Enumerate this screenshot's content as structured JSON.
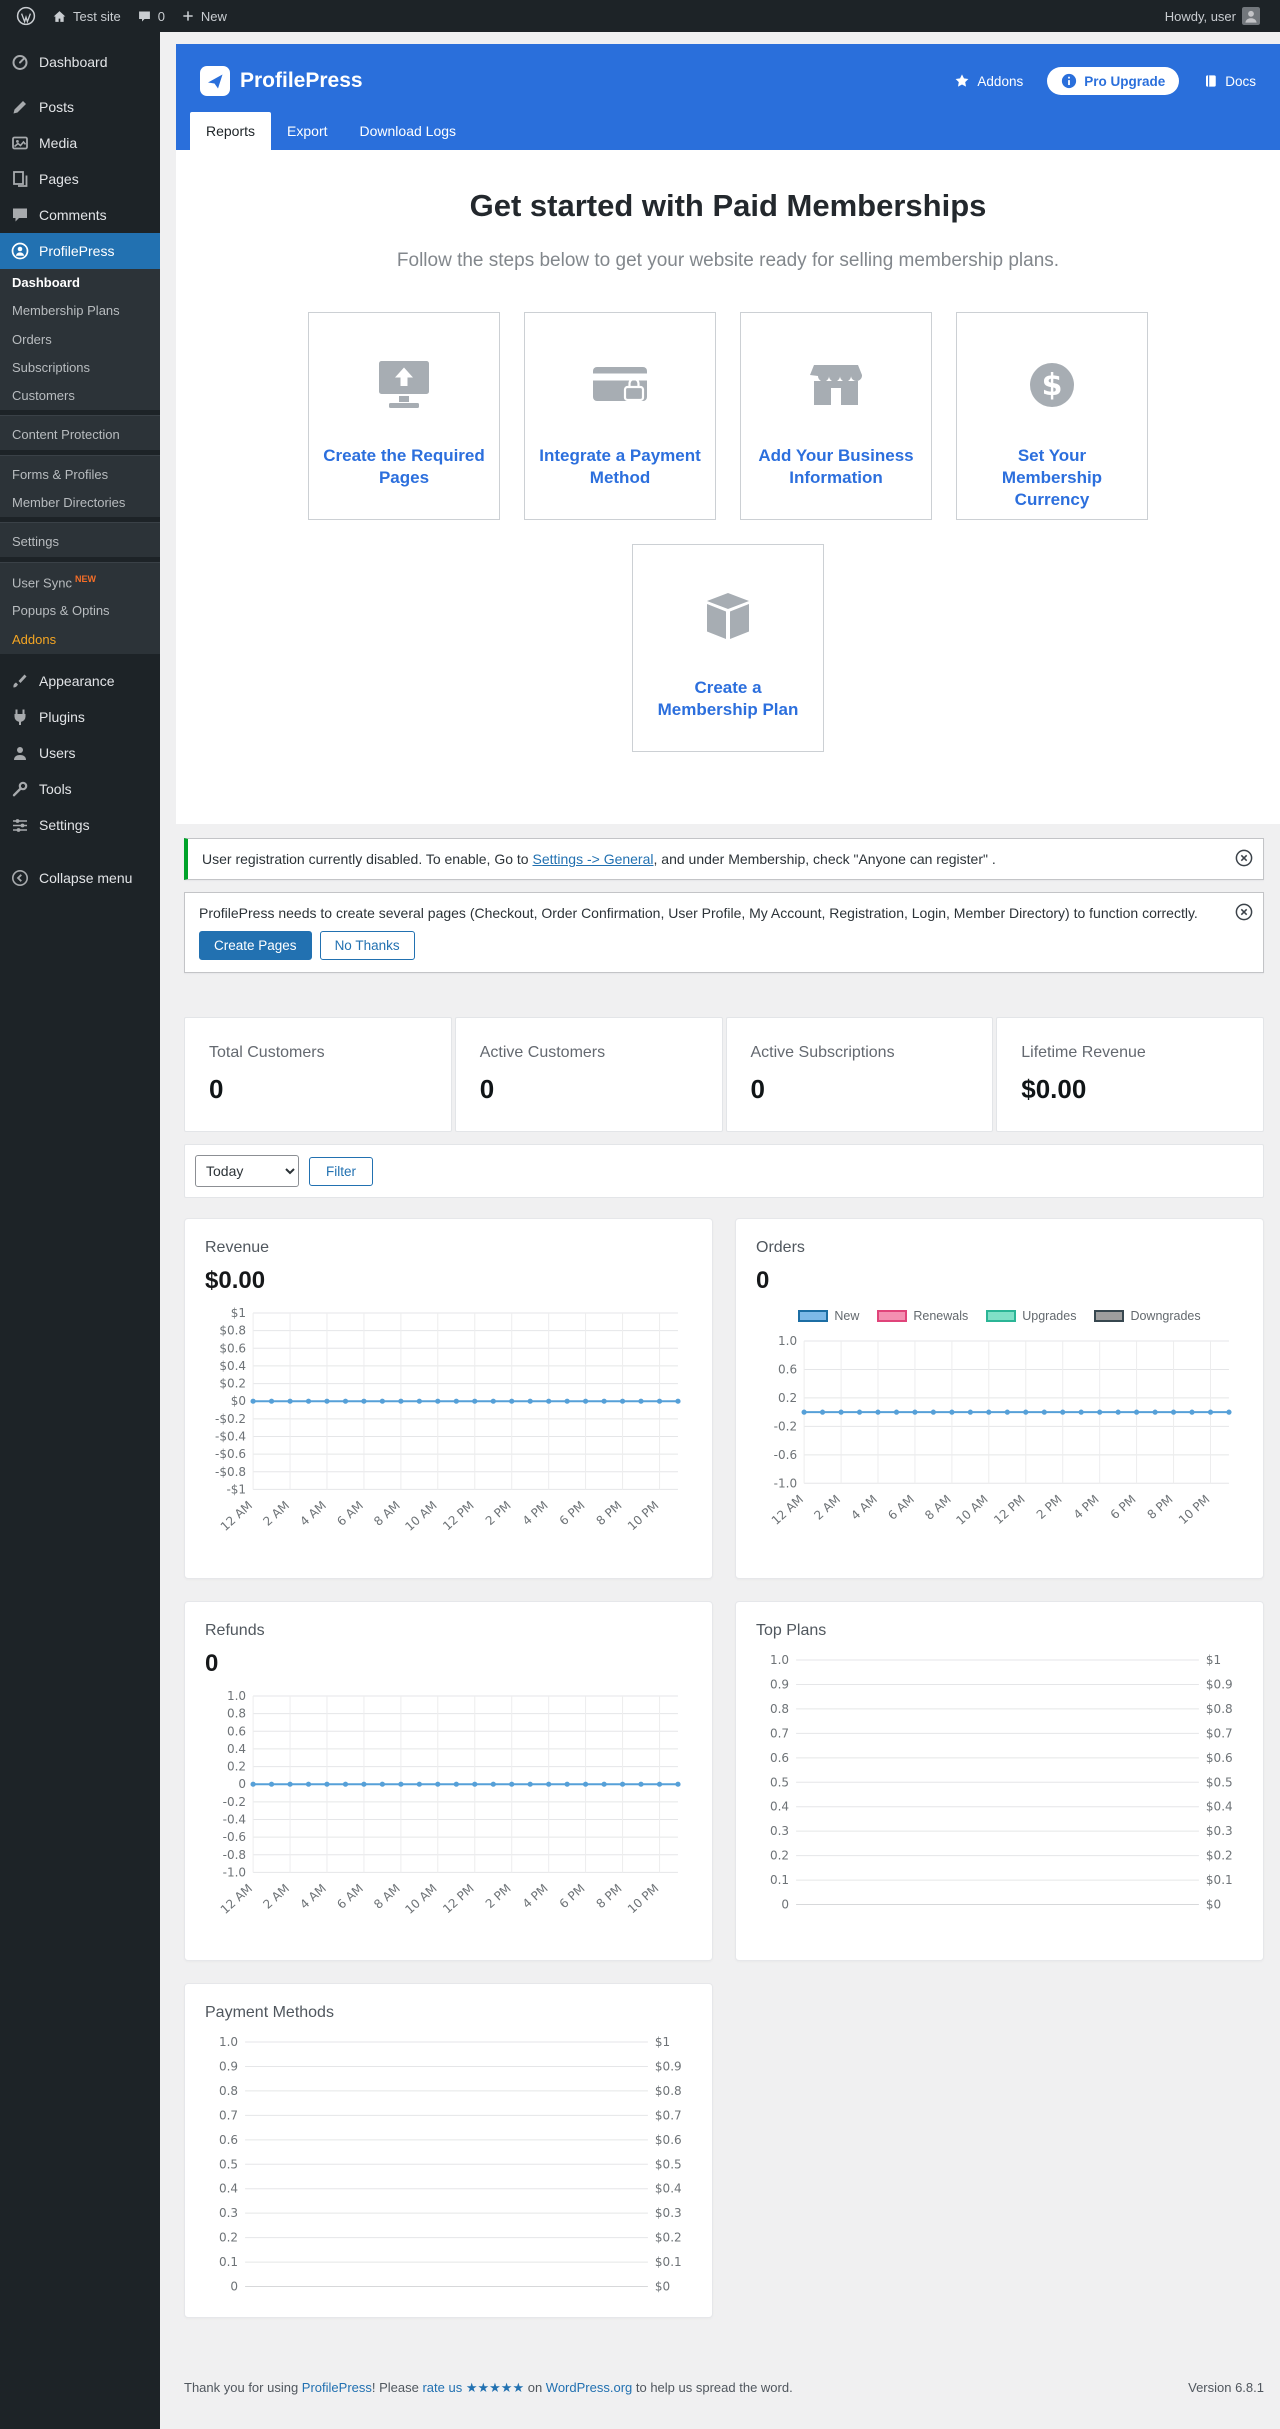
{
  "colors": {
    "accent_blue": "#2a6fdb",
    "wp_link_blue": "#2271b1",
    "chart_line_blue": "#56a0d8",
    "notice_green": "#00a32a",
    "sidebar_dark": "#1d2327",
    "addons_orange": "#f5a623"
  },
  "admin_bar": {
    "site_name": "Test site",
    "comments_count": "0",
    "new_label": "New",
    "howdy": "Howdy, user"
  },
  "sidebar": {
    "items": [
      {
        "type": "top",
        "slug": "dashboard",
        "icon": "dashboard",
        "label": "Dashboard"
      },
      {
        "type": "separator"
      },
      {
        "type": "top",
        "slug": "posts",
        "icon": "posts",
        "label": "Posts"
      },
      {
        "type": "top",
        "slug": "media",
        "icon": "media",
        "label": "Media"
      },
      {
        "type": "top",
        "slug": "pages",
        "icon": "pages",
        "label": "Pages"
      },
      {
        "type": "top",
        "slug": "comments",
        "icon": "comments",
        "label": "Comments"
      },
      {
        "type": "top",
        "slug": "profilepress",
        "icon": "profilepress",
        "label": "ProfilePress",
        "active": true
      },
      {
        "type": "sub",
        "slug": "pp-dashboard",
        "label": "Dashboard",
        "current": true
      },
      {
        "type": "sub",
        "slug": "membership-plans",
        "label": "Membership Plans"
      },
      {
        "type": "sub",
        "slug": "orders",
        "label": "Orders"
      },
      {
        "type": "sub",
        "slug": "subscriptions",
        "label": "Subscriptions"
      },
      {
        "type": "sub",
        "slug": "customers",
        "label": "Customers"
      },
      {
        "type": "sub",
        "slug": "content-protection",
        "label": "Content Protection",
        "group_start": true
      },
      {
        "type": "sub",
        "slug": "forms-profiles",
        "label": "Forms & Profiles",
        "group_start": true
      },
      {
        "type": "sub",
        "slug": "member-directories",
        "label": "Member Directories"
      },
      {
        "type": "sub",
        "slug": "pp-settings",
        "label": "Settings",
        "group_start": true
      },
      {
        "type": "sub",
        "slug": "user-sync",
        "label": "User Sync",
        "badge": "NEW",
        "group_start": true
      },
      {
        "type": "sub",
        "slug": "popups-optins",
        "label": "Popups & Optins"
      },
      {
        "type": "sub",
        "slug": "addons",
        "label": "Addons",
        "highlight": "orange"
      },
      {
        "type": "separator"
      },
      {
        "type": "top",
        "slug": "appearance",
        "icon": "appearance",
        "label": "Appearance"
      },
      {
        "type": "top",
        "slug": "plugins",
        "icon": "plugins",
        "label": "Plugins"
      },
      {
        "type": "top",
        "slug": "users",
        "icon": "users",
        "label": "Users"
      },
      {
        "type": "top",
        "slug": "tools",
        "icon": "tools",
        "label": "Tools"
      },
      {
        "type": "top",
        "slug": "settings",
        "icon": "settings",
        "label": "Settings"
      },
      {
        "type": "top",
        "slug": "collapse-menu",
        "icon": "collapse",
        "label": "Collapse menu",
        "gap": true
      }
    ]
  },
  "header": {
    "brand": "ProfilePress",
    "addons_label": "Addons",
    "pro_upgrade_label": "Pro Upgrade",
    "docs_label": "Docs",
    "tabs": [
      {
        "label": "Reports",
        "active": true
      },
      {
        "label": "Export",
        "active": false
      },
      {
        "label": "Download Logs",
        "active": false
      }
    ]
  },
  "hero": {
    "title": "Get started with Paid Memberships",
    "subtitle": "Follow the steps below to get your website ready for selling membership plans.",
    "cards": [
      {
        "label": "Create the Required Pages",
        "icon": "monitor-upload"
      },
      {
        "label": "Integrate a Payment Method",
        "icon": "payment-card"
      },
      {
        "label": "Add Your Business Information",
        "icon": "store"
      },
      {
        "label": "Set Your Membership Currency",
        "icon": "currency"
      },
      {
        "label": "Create a Membership Plan",
        "icon": "plan-box"
      }
    ]
  },
  "notices": [
    {
      "text_before": "User registration currently disabled. To enable, Go to ",
      "link_text": "Settings -> General",
      "text_after": ", and under Membership, check \"Anyone can register\" ."
    },
    {
      "text": "ProfilePress needs to create several pages (Checkout, Order Confirmation, User Profile, My Account, Registration, Login, Member Directory) to function correctly.",
      "primary_button": "Create Pages",
      "secondary_button": "No Thanks"
    }
  ],
  "stats": [
    {
      "label": "Total Customers",
      "value": "0"
    },
    {
      "label": "Active Customers",
      "value": "0"
    },
    {
      "label": "Active Subscriptions",
      "value": "0"
    },
    {
      "label": "Lifetime Revenue",
      "value": "$0.00"
    }
  ],
  "filter": {
    "selected": "Today",
    "button_label": "Filter"
  },
  "chart_data": [
    {
      "key": "revenue",
      "type": "line",
      "title": "Revenue",
      "value": "$0.00",
      "ylim": [
        -1,
        1
      ],
      "y_tick_labels": [
        "$1",
        "$0.8",
        "$0.6",
        "$0.4",
        "$0.2",
        "$0",
        "-$0.2",
        "-$0.4",
        "-$0.6",
        "-$0.8",
        "-$1"
      ],
      "x_tick_labels": [
        "12 AM",
        "2 AM",
        "4 AM",
        "6 AM",
        "8 AM",
        "10 AM",
        "12 PM",
        "2 PM",
        "4 PM",
        "6 PM",
        "8 PM",
        "10 PM"
      ],
      "points_per_label": 2,
      "series": [
        {
          "name": "Revenue",
          "color": "#56a0d8",
          "values": [
            0,
            0,
            0,
            0,
            0,
            0,
            0,
            0,
            0,
            0,
            0,
            0,
            0,
            0,
            0,
            0,
            0,
            0,
            0,
            0,
            0,
            0,
            0,
            0
          ]
        }
      ]
    },
    {
      "key": "orders",
      "type": "line",
      "title": "Orders",
      "value": "0",
      "legend": [
        {
          "label": "New",
          "fill": "#7db9e8",
          "border": "#1c6ea4"
        },
        {
          "label": "Renewals",
          "fill": "#f48fb1",
          "border": "#e0447a"
        },
        {
          "label": "Upgrades",
          "fill": "#80e0c7",
          "border": "#2bb596"
        },
        {
          "label": "Downgrades",
          "fill": "#9e9e9e",
          "border": "#37474f"
        }
      ],
      "ylim": [
        -1,
        1
      ],
      "y_tick_labels": [
        "1.0",
        "0.6",
        "0.2",
        "-0.2",
        "-0.6",
        "-1.0"
      ],
      "x_tick_labels": [
        "12 AM",
        "2 AM",
        "4 AM",
        "6 AM",
        "8 AM",
        "10 AM",
        "12 PM",
        "2 PM",
        "4 PM",
        "6 PM",
        "8 PM",
        "10 PM"
      ],
      "points_per_label": 2,
      "series": [
        {
          "name": "New",
          "color": "#56a0d8",
          "values": [
            0,
            0,
            0,
            0,
            0,
            0,
            0,
            0,
            0,
            0,
            0,
            0,
            0,
            0,
            0,
            0,
            0,
            0,
            0,
            0,
            0,
            0,
            0,
            0
          ]
        }
      ]
    },
    {
      "key": "refunds",
      "type": "line",
      "title": "Refunds",
      "value": "0",
      "ylim": [
        -1,
        1
      ],
      "y_tick_labels": [
        "1.0",
        "0.8",
        "0.6",
        "0.4",
        "0.2",
        "0",
        "-0.2",
        "-0.4",
        "-0.6",
        "-0.8",
        "-1.0"
      ],
      "x_tick_labels": [
        "12 AM",
        "2 AM",
        "4 AM",
        "6 AM",
        "8 AM",
        "10 AM",
        "12 PM",
        "2 PM",
        "4 PM",
        "6 PM",
        "8 PM",
        "10 PM"
      ],
      "points_per_label": 2,
      "series": [
        {
          "name": "Refunds",
          "color": "#56a0d8",
          "values": [
            0,
            0,
            0,
            0,
            0,
            0,
            0,
            0,
            0,
            0,
            0,
            0,
            0,
            0,
            0,
            0,
            0,
            0,
            0,
            0,
            0,
            0,
            0,
            0
          ]
        }
      ]
    },
    {
      "key": "top_plans",
      "type": "empty_dual_axis",
      "title": "Top Plans",
      "left_ticks": [
        "1.0",
        "0.9",
        "0.8",
        "0.7",
        "0.6",
        "0.5",
        "0.4",
        "0.3",
        "0.2",
        "0.1",
        "0"
      ],
      "right_ticks": [
        "$1",
        "$0.9",
        "$0.8",
        "$0.7",
        "$0.6",
        "$0.5",
        "$0.4",
        "$0.3",
        "$0.2",
        "$0.1",
        "$0"
      ],
      "series": []
    },
    {
      "key": "payment_methods",
      "type": "empty_dual_axis",
      "title": "Payment Methods",
      "left_ticks": [
        "1.0",
        "0.9",
        "0.8",
        "0.7",
        "0.6",
        "0.5",
        "0.4",
        "0.3",
        "0.2",
        "0.1",
        "0"
      ],
      "right_ticks": [
        "$1",
        "$0.9",
        "$0.8",
        "$0.7",
        "$0.6",
        "$0.5",
        "$0.4",
        "$0.3",
        "$0.2",
        "$0.1",
        "$0"
      ],
      "series": []
    }
  ],
  "footer": {
    "pre": "Thank you for using ",
    "link1": "ProfilePress",
    "mid1": "! Please ",
    "link2": "rate us ★★★★★",
    "mid2": " on ",
    "link3": "WordPress.org",
    "post": " to help us spread the word.",
    "version": "Version 6.8.1"
  }
}
